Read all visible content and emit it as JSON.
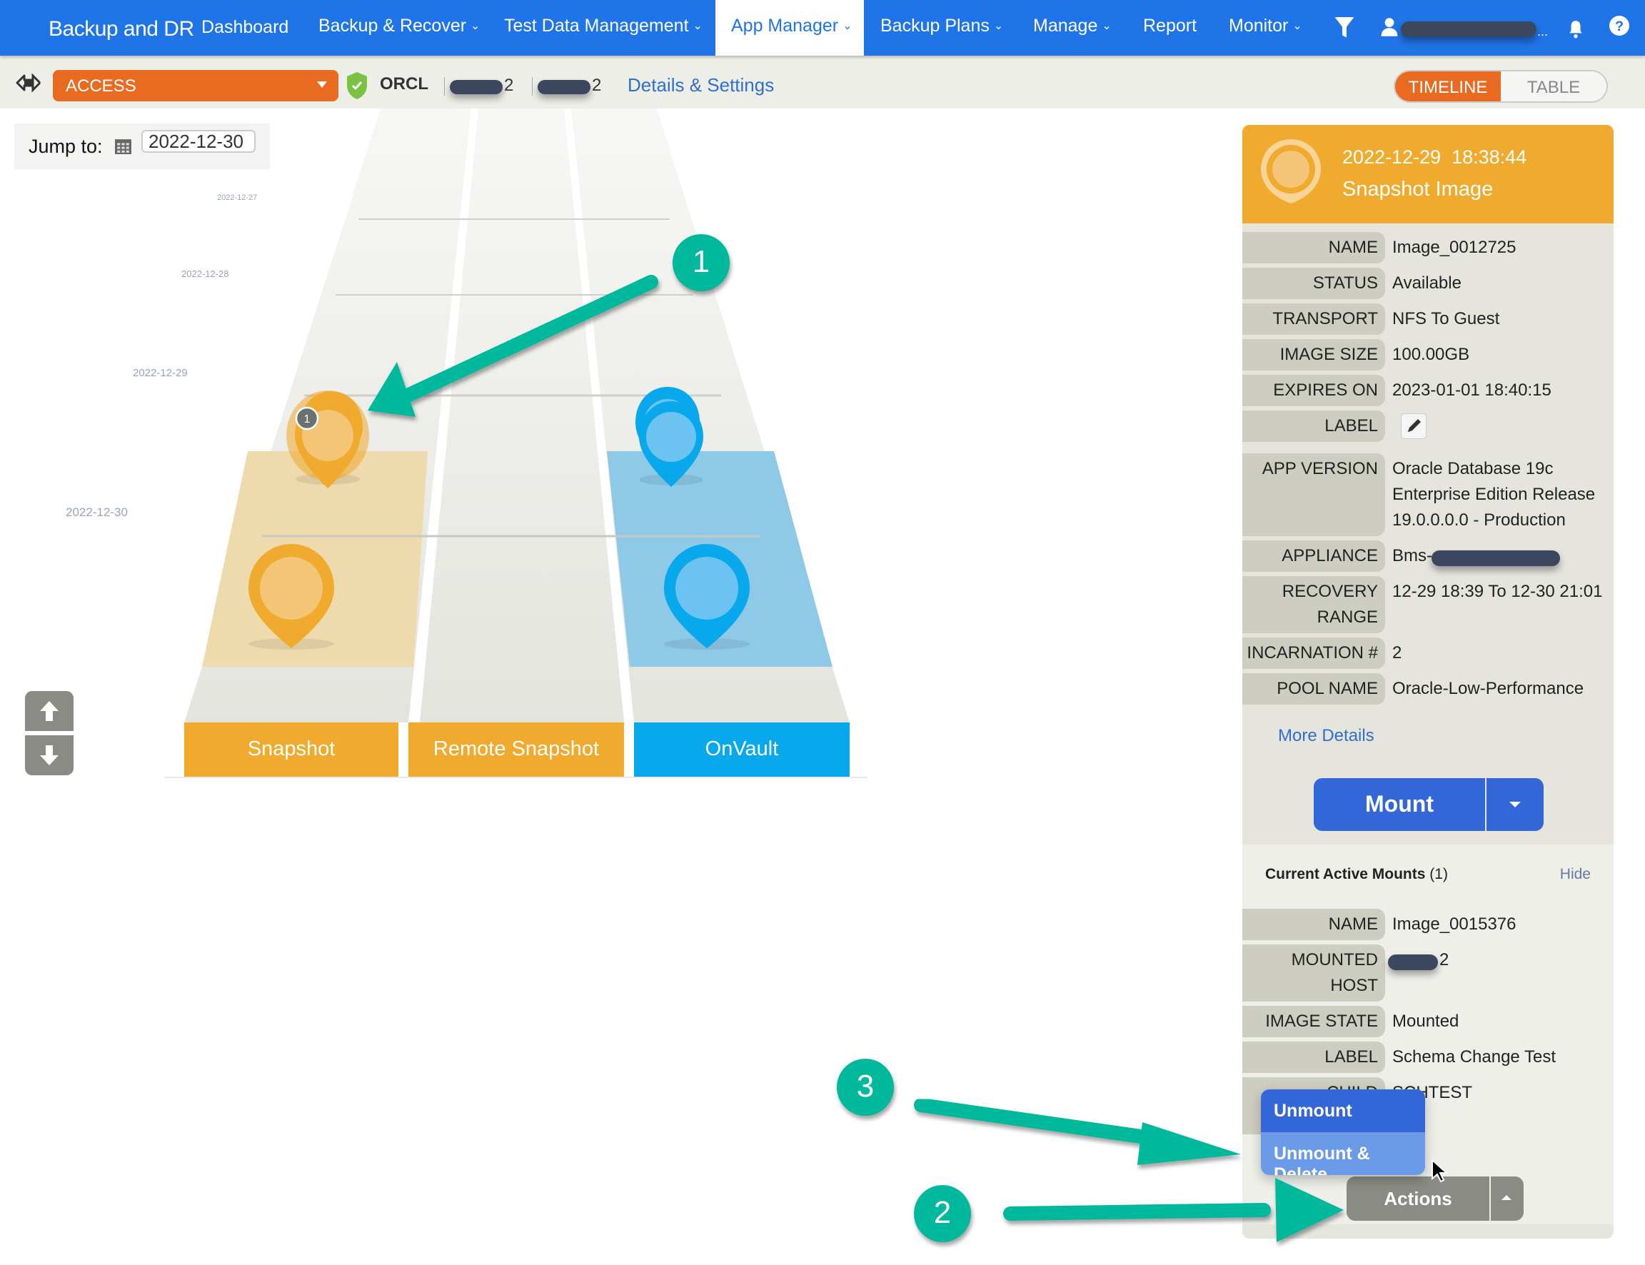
{
  "nav": {
    "brand": "Backup and DR",
    "items": [
      {
        "label": "Dashboard",
        "dropdown": false
      },
      {
        "label": "Backup & Recover",
        "dropdown": true
      },
      {
        "label": "Test Data Management",
        "dropdown": true
      },
      {
        "label": "App Manager",
        "dropdown": true,
        "active": true
      },
      {
        "label": "Backup Plans",
        "dropdown": true
      },
      {
        "label": "Manage",
        "dropdown": true
      },
      {
        "label": "Report",
        "dropdown": false
      },
      {
        "label": "Monitor",
        "dropdown": true
      }
    ],
    "chevron": "⌄",
    "icons": [
      "filter-icon",
      "user-icon",
      "bell-icon",
      "help-icon"
    ],
    "user_suffix": "..."
  },
  "toolbar": {
    "access_select": "ACCESS",
    "app_name": "ORCL",
    "host_suffix_1": "2",
    "host_suffix_2": "2",
    "details_link": "Details & Settings",
    "view_toggle": {
      "timeline": "TIMELINE",
      "table": "TABLE",
      "selected": "TIMELINE"
    }
  },
  "jump_to": {
    "label": "Jump to:",
    "value": "2022-12-30"
  },
  "timeline": {
    "dates": [
      "2022-12-27",
      "2022-12-28",
      "2022-12-29",
      "2022-12-30"
    ],
    "lanes": [
      "Snapshot",
      "Remote Snapshot",
      "OnVault"
    ],
    "cluster_badge": "1",
    "colors": {
      "snapshot": "#f0aa2d",
      "onvault": "#08a8ec",
      "remote": "#f0aa2d"
    }
  },
  "details": {
    "datetime": "2022-12-29  18:38:44",
    "type": "Snapshot Image",
    "fields": [
      {
        "key": "NAME",
        "value": "Image_0012725"
      },
      {
        "key": "STATUS",
        "value": "Available"
      },
      {
        "key": "TRANSPORT",
        "value": "NFS To Guest"
      },
      {
        "key": "IMAGE SIZE",
        "value": "100.00GB"
      },
      {
        "key": "EXPIRES ON",
        "value": "2023-01-01 18:40:15"
      },
      {
        "key": "LABEL",
        "value": ""
      },
      {
        "key": "APP VERSION",
        "value": "Oracle Database 19c Enterprise Edition Release 19.0.0.0.0 - Production"
      },
      {
        "key": "APPLIANCE",
        "value": "Bms-"
      },
      {
        "key": "RECOVERY RANGE",
        "value": "12-29 18:39 To 12-30 21:01"
      },
      {
        "key": "INCARNATION #",
        "value": "2"
      },
      {
        "key": "POOL NAME",
        "value": "Oracle-Low-Performance"
      }
    ],
    "more_details": "More Details",
    "mount_button": "Mount"
  },
  "active_mounts": {
    "title": "Current Active Mounts",
    "count": "(1)",
    "hide": "Hide",
    "fields": [
      {
        "key": "NAME",
        "value": "Image_0015376"
      },
      {
        "key": "MOUNTED HOST",
        "value": "2"
      },
      {
        "key": "IMAGE STATE",
        "value": "Mounted"
      },
      {
        "key": "LABEL",
        "value": "Schema Change Test"
      },
      {
        "key": "CHILD",
        "value": "SCHTEST"
      }
    ],
    "actions_button": "Actions",
    "actions_menu": [
      "Unmount",
      "Unmount & Delete"
    ]
  },
  "callouts": [
    "1",
    "2",
    "3"
  ]
}
